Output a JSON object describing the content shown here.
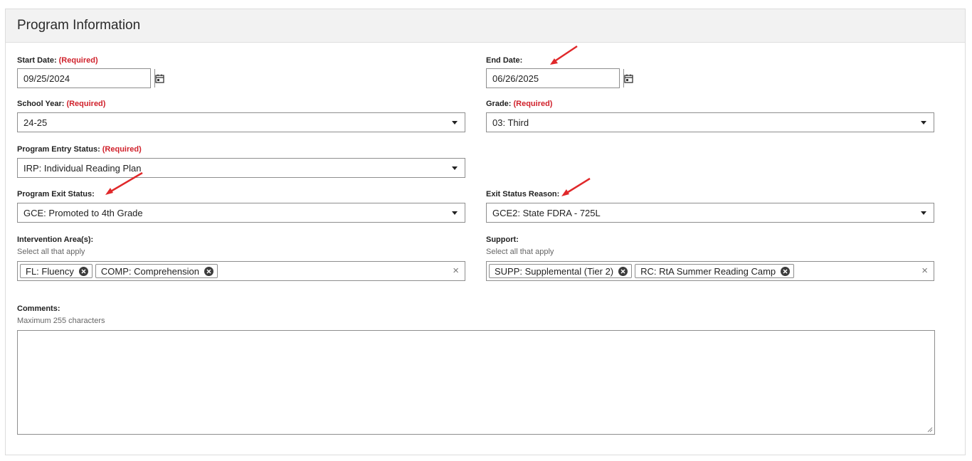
{
  "panel": {
    "title": "Program Information"
  },
  "required_text": "(Required)",
  "start_date": {
    "label": "Start Date:",
    "value": "09/25/2024"
  },
  "end_date": {
    "label": "End Date:",
    "value": "06/26/2025"
  },
  "school_year": {
    "label": "School Year:",
    "value": "24-25"
  },
  "grade": {
    "label": "Grade:",
    "value": "03: Third"
  },
  "entry_status": {
    "label": "Program Entry Status:",
    "value": "IRP: Individual Reading Plan"
  },
  "exit_status": {
    "label": "Program Exit Status:",
    "value": "GCE: Promoted to 4th Grade"
  },
  "exit_reason": {
    "label": "Exit Status Reason:",
    "value": "GCE2: State FDRA - 725L"
  },
  "intervention": {
    "label": "Intervention Area(s):",
    "hint": "Select all that apply",
    "chips": [
      "FL: Fluency",
      "COMP: Comprehension"
    ]
  },
  "support": {
    "label": "Support:",
    "hint": "Select all that apply",
    "chips": [
      "SUPP: Supplemental (Tier 2)",
      "RC: RtA Summer Reading Camp"
    ]
  },
  "comments": {
    "label": "Comments:",
    "hint": "Maximum 255 characters"
  },
  "colors": {
    "required": "#d0212b",
    "arrow": "#e0282a",
    "header_bg": "#f2f2f2"
  },
  "icons": {
    "calendar": "calendar-icon",
    "caret": "chevron-down-icon",
    "remove": "remove-chip-icon",
    "clear": "close-icon",
    "annotation": "red-arrow-icon"
  }
}
